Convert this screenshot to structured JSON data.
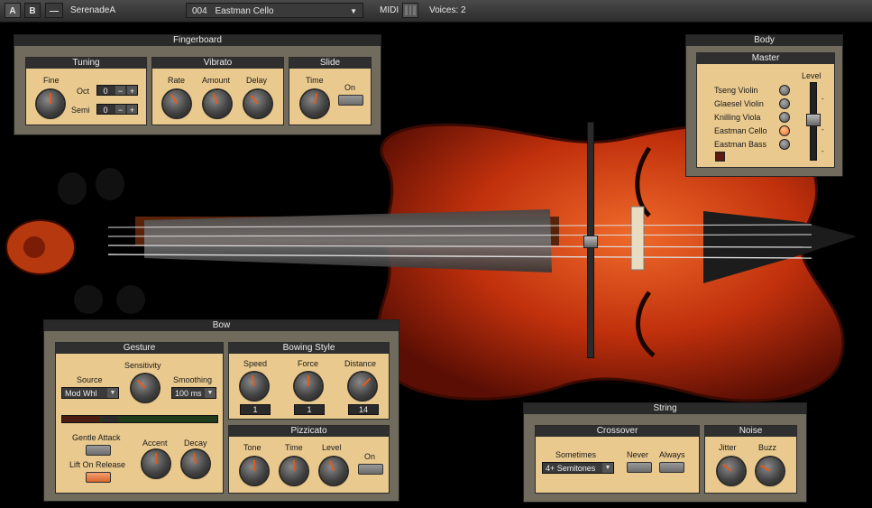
{
  "topbar": {
    "btn_a": "A",
    "btn_b": "B",
    "btn_minus": "—",
    "preset_name": "SerenadeA",
    "instrument_num": "004",
    "instrument_name": "Eastman Cello",
    "midi": "MIDI",
    "voices": "Voices: 2"
  },
  "fingerboard": {
    "title": "Fingerboard",
    "tuning": {
      "title": "Tuning",
      "fine": "Fine",
      "oct": "Oct",
      "semi": "Semi",
      "oct_val": "0",
      "semi_val": "0",
      "minus": "−",
      "plus": "+"
    },
    "vibrato": {
      "title": "Vibrato",
      "rate": "Rate",
      "amount": "Amount",
      "delay": "Delay"
    },
    "slide": {
      "title": "Slide",
      "time": "Time",
      "on": "On"
    }
  },
  "body": {
    "title": "Body",
    "master": "Master",
    "level": "Level",
    "instruments": [
      "Tseng Violin",
      "Glaesel Violin",
      "Knilling Viola",
      "Eastman Cello",
      "Eastman Bass"
    ],
    "selected_index": 3
  },
  "bow": {
    "title": "Bow",
    "gesture": {
      "title": "Gesture",
      "source": "Source",
      "sensitivity": "Sensitivity",
      "smoothing": "Smoothing",
      "source_val": "Mod Whl",
      "smoothing_val": "100 ms",
      "gentle_attack": "Gentle Attack",
      "accent": "Accent",
      "decay": "Decay",
      "lift_on_release": "Lift On Release"
    },
    "bowing_style": {
      "title": "Bowing Style",
      "speed": "Speed",
      "force": "Force",
      "distance": "Distance",
      "speed_val": "1",
      "force_val": "1",
      "distance_val": "14"
    },
    "pizzicato": {
      "title": "Pizzicato",
      "tone": "Tone",
      "time": "Time",
      "level": "Level",
      "on": "On"
    }
  },
  "string": {
    "title": "String",
    "crossover": {
      "title": "Crossover",
      "sometimes": "Sometimes",
      "never": "Never",
      "always": "Always",
      "sometimes_val": "4+ Semitones"
    },
    "noise": {
      "title": "Noise",
      "jitter": "Jitter",
      "buzz": "Buzz"
    }
  },
  "colors": {
    "accent": "#e8692a",
    "panel": "#706b5c",
    "wood_panel": "#e9c98e",
    "violin_body": "#c0300c"
  }
}
